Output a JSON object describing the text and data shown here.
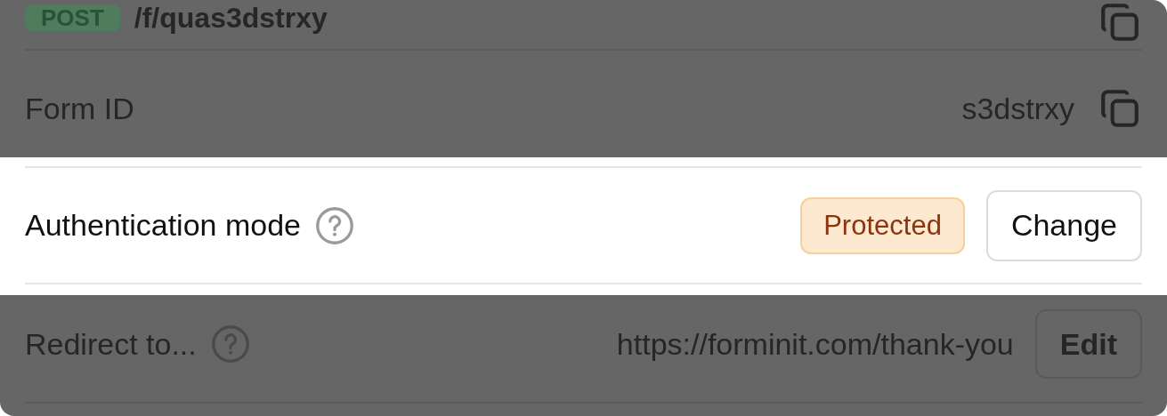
{
  "rows": [
    {
      "highlighted": false,
      "method": "POST",
      "path": "/f/quas3dstrxy",
      "copyable": true
    },
    {
      "highlighted": false,
      "label": "Form ID",
      "value": "s3dstrxy",
      "copyable": true
    },
    {
      "highlighted": true,
      "label": "Authentication mode",
      "help": true,
      "badge": "Protected",
      "button": "Change"
    },
    {
      "highlighted": false,
      "label": "Redirect to...",
      "help": true,
      "value": "https://forminit.com/thank-you",
      "button": "Edit"
    }
  ]
}
